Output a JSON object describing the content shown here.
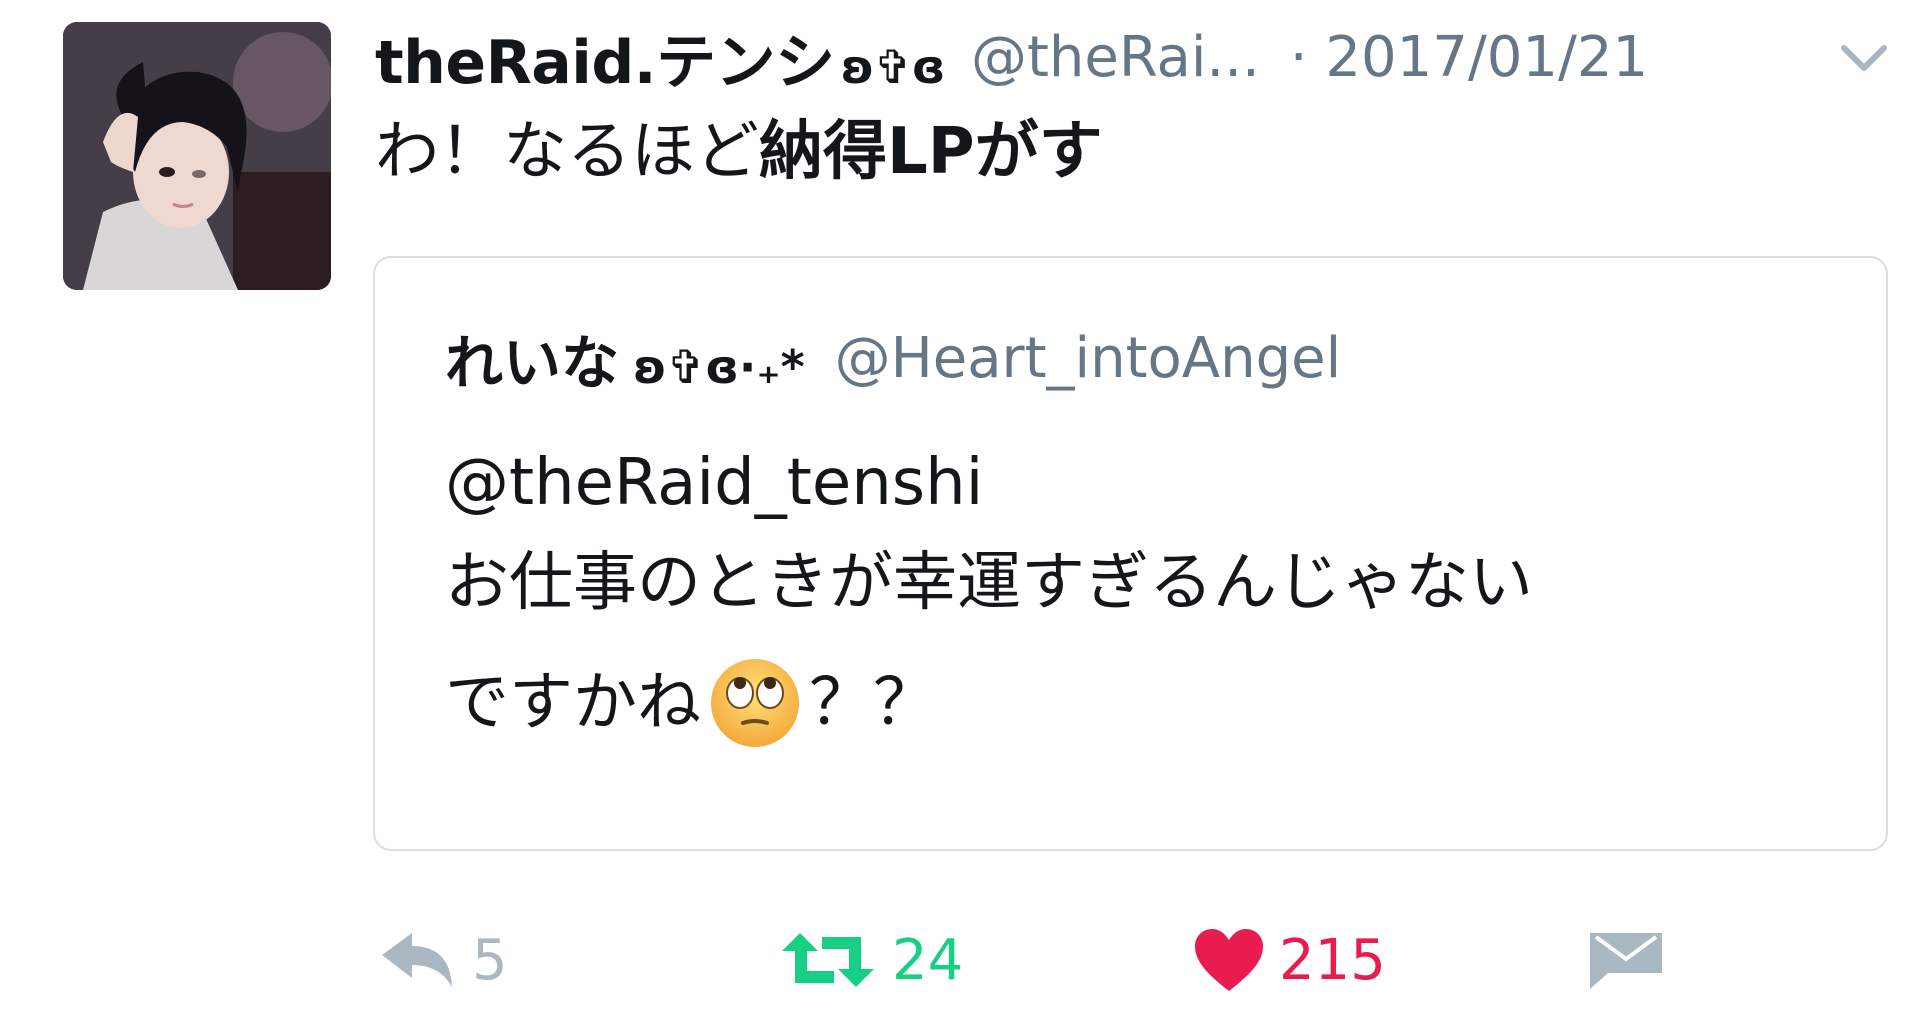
{
  "tweet": {
    "author": {
      "display_name": "theRaid.テンシ",
      "display_name_deco": "ʚ✞ɞ",
      "handle": "@theRai..."
    },
    "timestamp": "· 2017/01/21",
    "text_plain": "わ！なるほど",
    "text_bold": "納得LPがす"
  },
  "quoted_tweet": {
    "author": {
      "display_name": "れいな",
      "display_name_deco": "ʚ✞ɞ·₊*",
      "handle": "@Heart_intoAngel"
    },
    "mention": "@theRaid_tenshi",
    "line1": "お仕事のときが幸運すぎるんじゃない",
    "line2_before_emoji": "ですかね",
    "line2_after_emoji": "？？",
    "emoji": "face-with-rolling-eyes"
  },
  "actions": {
    "reply_count": "5",
    "retweet_count": "24",
    "like_count": "215"
  },
  "colors": {
    "retweet_active": "#19cf86",
    "like_active": "#e81c4f",
    "muted": "#aab8c2",
    "secondary_text": "#657786"
  }
}
